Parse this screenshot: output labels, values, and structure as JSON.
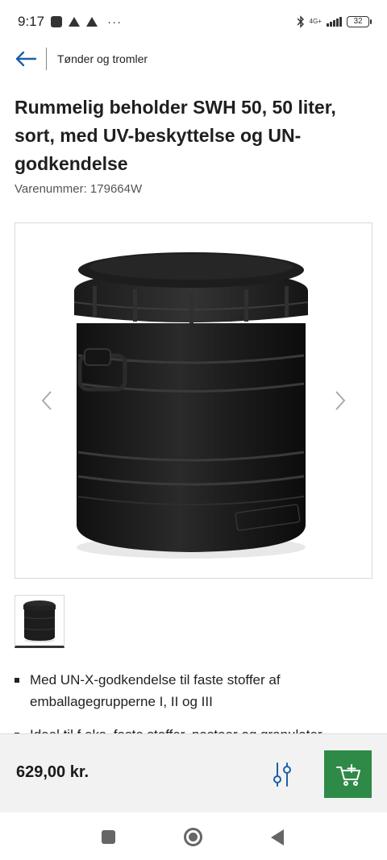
{
  "status_bar": {
    "time": "9:17",
    "network": "4G+",
    "battery": "32"
  },
  "nav": {
    "back_icon": "arrow-left-icon",
    "breadcrumb": "Tønder og tromler"
  },
  "product": {
    "title": "Rummelig beholder SWH 50, 50 liter, sort, med UV-beskyttelse og UN-godkendelse",
    "sku": "Varenummer: 179664W"
  },
  "gallery": {
    "prev_icon": "chevron-left-icon",
    "next_icon": "chevron-right-icon"
  },
  "features": [
    "Med UN-X-godkendelse til faste stoffer af emballagegrupperne I, II og III",
    "Ideel til f.eks. faste stoffer, pastaer og granulater"
  ],
  "buybar": {
    "price": "629,00 kr.",
    "filter_icon": "sliders-icon",
    "cart_icon": "cart-add-icon"
  },
  "colors": {
    "accent_green": "#2e8a47",
    "back_arrow_blue": "#1d5fa8",
    "filter_blue": "#1d5fa8"
  }
}
